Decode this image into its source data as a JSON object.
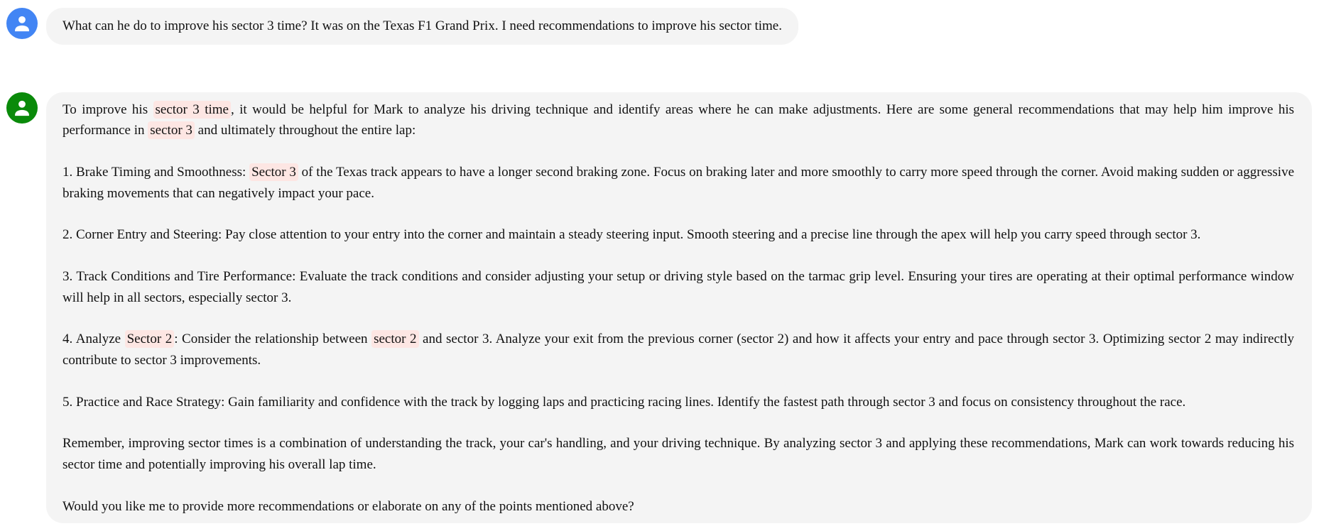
{
  "colors": {
    "user_avatar": "#4285f4",
    "assistant_avatar": "#0a8a0a",
    "bubble": "#f4f4f4",
    "highlight": "#fde6e3"
  },
  "user": {
    "avatar_icon": "person-icon",
    "message": "What can he do to improve his sector 3 time? It was on the Texas F1 Grand Prix. I need recommendations to improve his sector time."
  },
  "assistant": {
    "avatar_icon": "person-icon",
    "paragraphs": [
      [
        {
          "t": "To improve his "
        },
        {
          "t": "sector 3 time",
          "h": true
        },
        {
          "t": ", it would be helpful for Mark to analyze his driving technique and identify areas where he can make adjustments. Here are some general recommendations that may help him improve his performance in "
        },
        {
          "t": "sector 3",
          "h": true
        },
        {
          "t": " and ultimately throughout the entire lap:"
        }
      ],
      [
        {
          "t": "1. Brake Timing and Smoothness: "
        },
        {
          "t": "Sector 3",
          "h": true
        },
        {
          "t": " of the Texas track appears to have a longer second braking zone. Focus on braking later and more smoothly to carry more speed through the corner. Avoid making sudden or aggressive braking movements that can negatively impact your pace."
        }
      ],
      [
        {
          "t": "2. Corner Entry and Steering: Pay close attention to your entry into the corner and maintain a steady steering input. Smooth steering and a precise line through the apex will help you carry speed through sector 3."
        }
      ],
      [
        {
          "t": "3. Track Conditions and Tire Performance: Evaluate the track conditions and consider adjusting your setup or driving style based on the tarmac grip level. Ensuring your tires are operating at their optimal performance window will help in all sectors, especially sector 3."
        }
      ],
      [
        {
          "t": "4. Analyze "
        },
        {
          "t": "Sector 2",
          "h": true
        },
        {
          "t": ": Consider the relationship between "
        },
        {
          "t": "sector 2",
          "h": true
        },
        {
          "t": " and sector 3. Analyze your exit from the previous corner (sector 2) and how it affects your entry and pace through sector 3. Optimizing sector 2 may indirectly contribute to sector 3 improvements."
        }
      ],
      [
        {
          "t": "5. Practice and Race Strategy: Gain familiarity and confidence with the track by logging laps and practicing racing lines. Identify the fastest path through sector 3 and focus on consistency throughout the race."
        }
      ],
      [
        {
          "t": "Remember, improving sector times is a combination of understanding the track, your car's handling, and your driving technique. By analyzing sector 3 and applying these recommendations, Mark can work towards reducing his sector time and potentially improving his overall lap time."
        }
      ],
      [
        {
          "t": "Would you like me to provide more recommendations or elaborate on any of the points mentioned above?"
        }
      ]
    ]
  }
}
